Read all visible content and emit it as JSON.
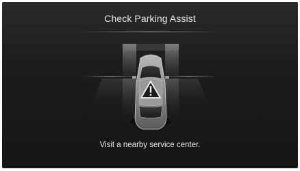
{
  "screen": {
    "title": "Check Parking Assist",
    "message": "Visit a nearby service center.",
    "background_color": "#1c1c1c",
    "text_color": "#e8e8e8"
  },
  "illustration": {
    "vehicle_icon": "car-top-view-icon",
    "status_icon": "warning-triangle-icon"
  }
}
